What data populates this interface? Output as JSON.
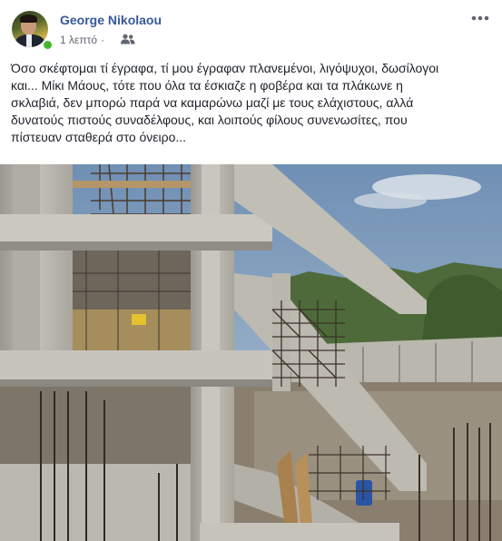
{
  "post": {
    "author_name": "George Nikolaou",
    "timestamp": "1 λεπτό",
    "separator": "·",
    "audience_icon": "friends-icon",
    "more_icon": "more-options-icon",
    "text": "Όσο σκέφτομαι τί έγραφα, τί μου έγραφαν πλανεμένοι, λιγόψυχοι, δωσίλογοι\nκαι... Μίκι Μάους, τότε που όλα τα έσκιαζε η φοβέρα και τα πλάκωνε η\nσκλαβιά, δεν μπορώ παρά να καμαρώνω μαζί με τους ελάχιστους, αλλά\nδυνατούς πιστούς συναδέλφους, και λοιπούς φίλους συνενωσίτες, που\nπίστευαν σταθερά στο όνειρο...",
    "online_status_color": "#42b72a",
    "author_color": "#385898"
  }
}
